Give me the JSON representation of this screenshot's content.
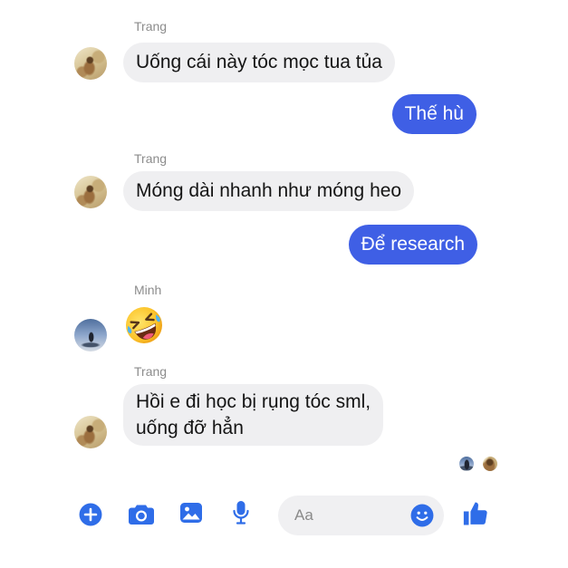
{
  "theme": {
    "background": "#ffffff",
    "incoming_bubble": "#efeff1",
    "incoming_text": "#151515",
    "outgoing_bubble": "#3f5fe5",
    "outgoing_text": "#ffffff",
    "sender_label": "#8c8c8c",
    "accent_icon": "#2f6de8",
    "composer_field": "#f0f0f2",
    "placeholder": "#8a8a8a"
  },
  "thread": {
    "messages": [
      {
        "outgoing": false,
        "sender": "Trang",
        "avatar": "trang-avatar",
        "lines": [
          "Uống cái này tóc mọc tua tủa"
        ]
      },
      {
        "outgoing": true,
        "lines": [
          "Thế hù"
        ]
      },
      {
        "outgoing": false,
        "sender": "Trang",
        "avatar": "trang-avatar",
        "lines": [
          "Móng dài nhanh như móng heo"
        ]
      },
      {
        "outgoing": true,
        "lines": [
          "Để research"
        ]
      },
      {
        "outgoing": false,
        "sender": "Minh",
        "avatar": "minh-avatar",
        "emoji": "rolling-on-floor-laughing-emoji"
      },
      {
        "outgoing": false,
        "sender": "Trang",
        "avatar": "trang-avatar",
        "lines": [
          "Hồi e đi học bị rụng tóc sml,",
          "uống đỡ hẳn"
        ]
      }
    ],
    "seen_by": [
      "minh-avatar",
      "trang-avatar"
    ]
  },
  "composer": {
    "left_actions": [
      {
        "icon": "plus-circle-icon"
      },
      {
        "icon": "camera-icon"
      },
      {
        "icon": "image-icon"
      },
      {
        "icon": "microphone-icon"
      }
    ],
    "input": {
      "placeholder": "Aa",
      "value": ""
    },
    "emoji_icon": "smiley-icon",
    "send_icon": "thumbs-up-icon"
  }
}
